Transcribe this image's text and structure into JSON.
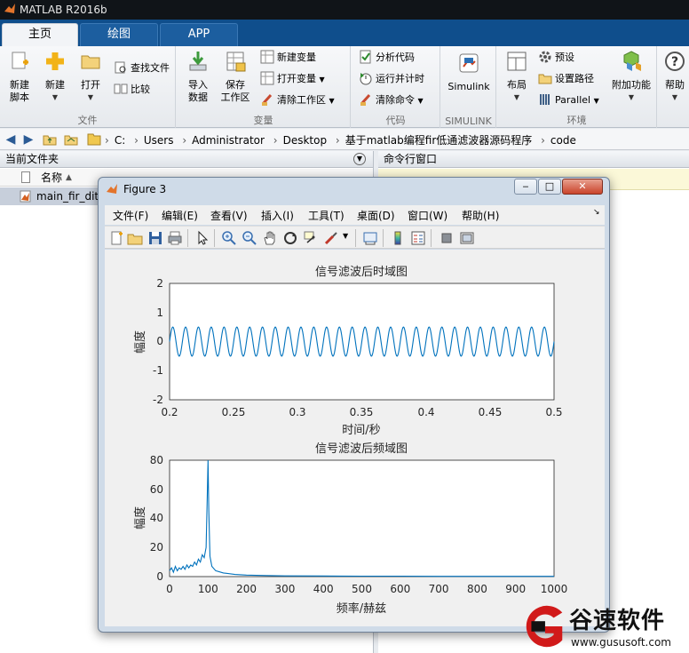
{
  "app": {
    "title": "MATLAB R2016b"
  },
  "tabs": [
    {
      "label": "主页",
      "active": true
    },
    {
      "label": "绘图",
      "active": false
    },
    {
      "label": "APP",
      "active": false
    }
  ],
  "ribbon": {
    "file": {
      "label": "文件",
      "new_script": "新建\n脚本",
      "new": "新建",
      "open": "打开",
      "find_files": "查找文件",
      "compare": "比较"
    },
    "variable": {
      "label": "变量",
      "import": "导入\n数据",
      "save_ws": "保存\n工作区",
      "new_var": "新建变量",
      "open_var": "打开变量",
      "clear_ws": "清除工作区"
    },
    "code": {
      "label": "代码",
      "analyze": "分析代码",
      "run_time": "运行并计时",
      "clear_cmd": "清除命令"
    },
    "simulink": {
      "label": "SIMULINK",
      "simulink": "Simulink"
    },
    "environment": {
      "label": "环境",
      "layout": "布局",
      "preferences": "预设",
      "set_path": "设置路径",
      "parallel": "Parallel",
      "addons": "附加功能"
    },
    "help": "帮助"
  },
  "address": {
    "crumbs": [
      "C:",
      "Users",
      "Administrator",
      "Desktop",
      "基于matlab编程fir低通滤波器源码程序",
      "code"
    ]
  },
  "left_panel": {
    "title": "当前文件夹",
    "column_name": "名称",
    "file": "main_fir_dito"
  },
  "right_panel": {
    "title": "命令行窗口"
  },
  "figure": {
    "title": "Figure 3",
    "menu": [
      "文件(F)",
      "编辑(E)",
      "查看(V)",
      "插入(I)",
      "工具(T)",
      "桌面(D)",
      "窗口(W)",
      "帮助(H)"
    ]
  },
  "chart_data": [
    {
      "type": "line",
      "title": "信号滤波后时域图",
      "xlabel": "时间/秒",
      "ylabel": "幅度",
      "xlim": [
        0.2,
        0.5
      ],
      "ylim": [
        -2,
        2
      ],
      "xticks": [
        "0.2",
        "0.25",
        "0.3",
        "0.35",
        "0.4",
        "0.45",
        "0.5"
      ],
      "yticks": [
        "2",
        "1",
        "0",
        "-1",
        "-2"
      ],
      "series": [
        {
          "amplitude": 0.5,
          "frequency_hz": 100,
          "color": "#0072bd"
        }
      ]
    },
    {
      "type": "line",
      "title": "信号滤波后频域图",
      "xlabel": "频率/赫兹",
      "ylabel": "幅度",
      "xlim": [
        0,
        1000
      ],
      "ylim": [
        0,
        80
      ],
      "xticks": [
        "0",
        "100",
        "200",
        "300",
        "400",
        "500",
        "600",
        "700",
        "800",
        "900",
        "1000"
      ],
      "yticks": [
        "80",
        "60",
        "40",
        "20",
        "0"
      ],
      "series": [
        {
          "color": "#0072bd",
          "x": [
            0,
            5,
            10,
            15,
            20,
            25,
            30,
            35,
            40,
            45,
            50,
            55,
            60,
            65,
            70,
            75,
            80,
            85,
            90,
            95,
            98,
            100,
            102,
            105,
            110,
            120,
            140,
            170,
            200,
            250,
            300,
            400,
            500,
            600,
            700,
            800,
            900,
            1000
          ],
          "y": [
            4,
            6,
            3,
            7,
            4,
            6,
            5,
            7,
            5,
            8,
            6,
            8,
            7,
            10,
            8,
            12,
            10,
            15,
            13,
            20,
            55,
            80,
            45,
            14,
            7,
            4,
            2.5,
            1.5,
            1,
            0.7,
            0.5,
            0.4,
            0.3,
            0.3,
            0.2,
            0.2,
            0.2,
            0.2
          ]
        }
      ]
    }
  ],
  "watermark": {
    "brand": "谷速软件",
    "url": "www.gususoft.com"
  }
}
